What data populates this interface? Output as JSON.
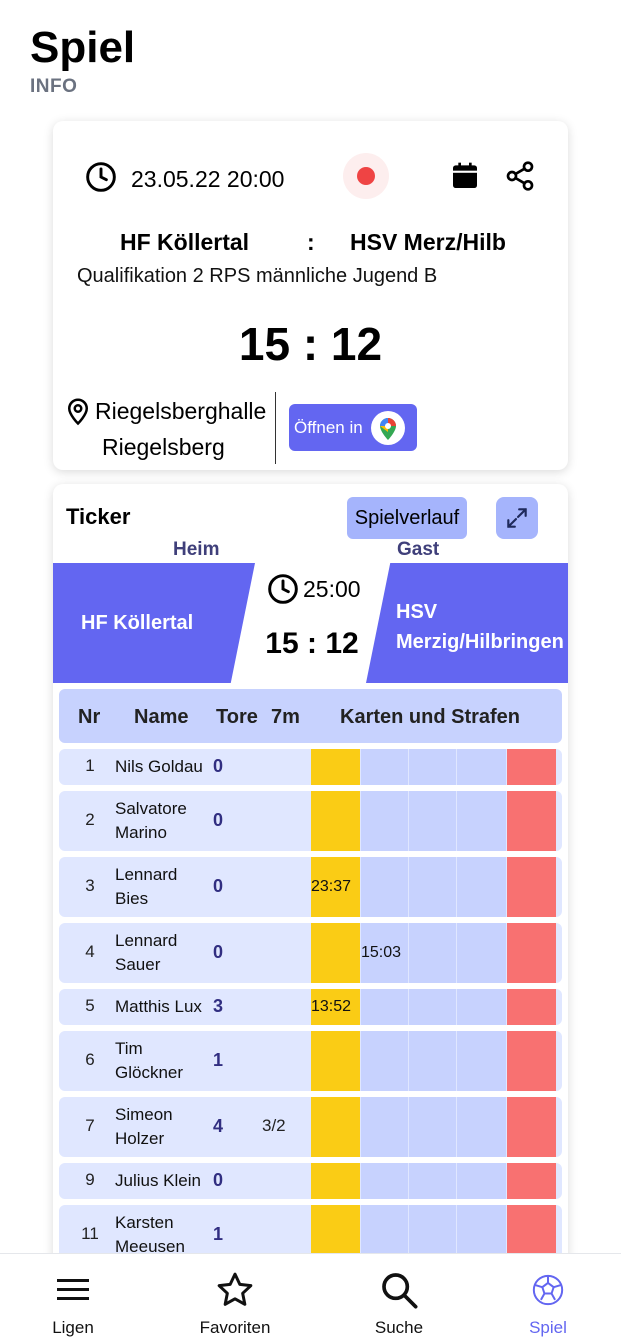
{
  "header": {
    "title": "Spiel",
    "subtitle": "INFO"
  },
  "match": {
    "datetime": "23.05.22 20:00",
    "home_team": "HF Köllertal",
    "separator": ":",
    "guest_team": "HSV Merz/Hilb",
    "league": "Qualifikation 2 RPS männliche Jugend B",
    "score": "15 : 12",
    "venue_line1": "Riegelsberghalle",
    "venue_line2": "Riegelsberg",
    "maps_button": "Öffnen in",
    "live_color": "#ef4444"
  },
  "ticker": {
    "title": "Ticker",
    "history_button": "Spielverlauf",
    "home_label": "Heim",
    "guest_label": "Gast",
    "home_team": "HF Köllertal",
    "guest_team_line1": "HSV",
    "guest_team_line2": "Merzig/Hilbringen",
    "clock": "25:00",
    "score": "15 : 12",
    "columns": {
      "nr": "Nr",
      "name": "Name",
      "tore": "Tore",
      "sm": "7m",
      "karten": "Karten und Strafen"
    },
    "players": [
      {
        "nr": "1",
        "name": "Nils Goldau",
        "tore": "0",
        "sm": "",
        "yellow": "",
        "pen1": ""
      },
      {
        "nr": "2",
        "name": "Salvatore Marino",
        "tore": "0",
        "sm": "",
        "yellow": "",
        "pen1": ""
      },
      {
        "nr": "3",
        "name": "Lennard Bies",
        "tore": "0",
        "sm": "",
        "yellow": "23:37",
        "pen1": ""
      },
      {
        "nr": "4",
        "name": "Lennard Sauer",
        "tore": "0",
        "sm": "",
        "yellow": "",
        "pen1": "15:03"
      },
      {
        "nr": "5",
        "name": "Matthis Lux",
        "tore": "3",
        "sm": "",
        "yellow": "13:52",
        "pen1": ""
      },
      {
        "nr": "6",
        "name": "Tim Glöckner",
        "tore": "1",
        "sm": "",
        "yellow": "",
        "pen1": ""
      },
      {
        "nr": "7",
        "name": "Simeon Holzer",
        "tore": "4",
        "sm": "3/2",
        "yellow": "",
        "pen1": ""
      },
      {
        "nr": "9",
        "name": "Julius Klein",
        "tore": "0",
        "sm": "",
        "yellow": "",
        "pen1": ""
      },
      {
        "nr": "11",
        "name": "Karsten Meeusen",
        "tore": "1",
        "sm": "",
        "yellow": "",
        "pen1": ""
      }
    ]
  },
  "nav": {
    "items": [
      {
        "label": "Ligen",
        "icon": "menu-icon"
      },
      {
        "label": "Favoriten",
        "icon": "star-icon"
      },
      {
        "label": "Suche",
        "icon": "search-icon"
      },
      {
        "label": "Spiel",
        "icon": "handball-icon"
      }
    ],
    "active_color": "#6366f1"
  }
}
